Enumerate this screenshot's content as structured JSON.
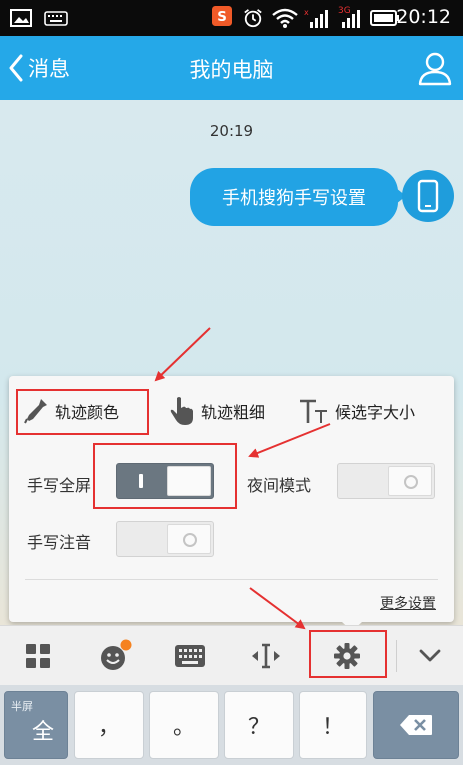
{
  "status_bar": {
    "time": "20:12",
    "network_label": "3G",
    "icons": [
      "image-icon",
      "keyboard-icon",
      "sogou-icon",
      "alarm-icon",
      "wifi-icon",
      "signal-icon",
      "battery-icon"
    ]
  },
  "nav": {
    "back_label": "消息",
    "title": "我的电脑",
    "profile_icon": "person-icon"
  },
  "chat": {
    "time": "20:19",
    "message": "手机搜狗手写设置",
    "avatar_icon": "phone-icon"
  },
  "settings_panel": {
    "options": [
      {
        "label": "轨迹颜色",
        "icon": "eyedropper-icon"
      },
      {
        "label": "轨迹粗细",
        "icon": "hand-pointer-icon"
      },
      {
        "label": "候选字大小",
        "icon": "text-size-icon"
      }
    ],
    "toggles": [
      {
        "label": "手写全屏",
        "on": true
      },
      {
        "label": "夜间模式",
        "on": false
      },
      {
        "label": "手写注音",
        "on": false
      }
    ],
    "more_label": "更多设置"
  },
  "keyboard_toolbar": {
    "buttons": [
      "grid-icon",
      "emoji-icon",
      "keyboard-icon",
      "cursor-move-icon",
      "gear-icon",
      "chevron-down-icon"
    ]
  },
  "keyboard": {
    "left_key_label": "全",
    "left_key_sub": "半屏",
    "keys": [
      "，",
      "。",
      "？",
      "！"
    ],
    "backspace_icon": "backspace-icon"
  },
  "colors": {
    "accent": "#25a8e8",
    "bubble": "#22a3e4",
    "annotation": "#e53131"
  }
}
